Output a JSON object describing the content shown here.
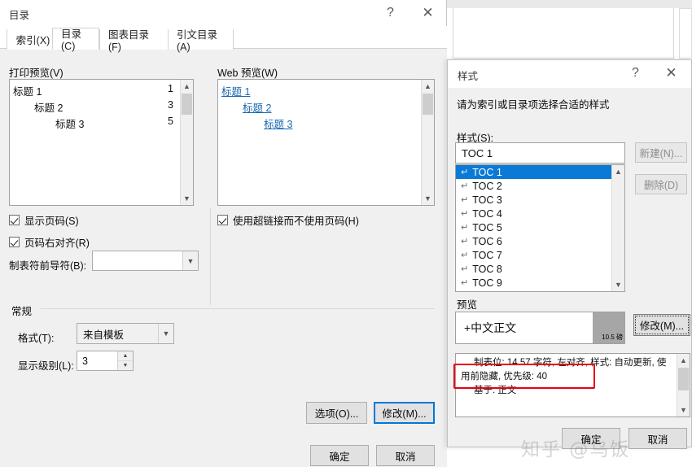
{
  "background": {
    "description": "word-document-page"
  },
  "toc_dialog": {
    "title": "目录",
    "help_icon": "?",
    "close_icon": "✕",
    "tabs": [
      {
        "label": "索引(X)",
        "active": false
      },
      {
        "label": "目录(C)",
        "active": true
      },
      {
        "label": "图表目录(F)",
        "active": false
      },
      {
        "label": "引文目录(A)",
        "active": false
      }
    ],
    "print_preview": {
      "label": "打印预览(V)",
      "lines": [
        {
          "text": "标题 1",
          "page": "1",
          "indent": 0
        },
        {
          "text": "标题 2",
          "page": "3",
          "indent": 26
        },
        {
          "text": "标题 3",
          "page": "5",
          "indent": 52
        }
      ]
    },
    "web_preview": {
      "label": "Web 预览(W)",
      "lines": [
        {
          "text": "标题 1",
          "indent": 0
        },
        {
          "text": "标题 2",
          "indent": 26
        },
        {
          "text": "标题 3",
          "indent": 52
        }
      ]
    },
    "checkbox_show_page_numbers": {
      "label": "显示页码(S)",
      "checked": true
    },
    "checkbox_right_align": {
      "label": "页码右对齐(R)",
      "checked": true
    },
    "checkbox_hyperlinks": {
      "label": "使用超链接而不使用页码(H)",
      "checked": true
    },
    "tab_leader": {
      "label": "制表符前导符(B):",
      "value": ""
    },
    "general": {
      "group_label": "常规",
      "format_label": "格式(T):",
      "format_value": "来自模板",
      "levels_label": "显示级别(L):",
      "levels_value": "3"
    },
    "options_button": "选项(O)...",
    "modify_button": "修改(M)...",
    "ok_button": "确定",
    "cancel_button": "取消"
  },
  "styles_dialog": {
    "title": "样式",
    "help_icon": "?",
    "close_icon": "✕",
    "instruction": "请为索引或目录项选择合适的样式",
    "styles_label": "样式(S):",
    "style_input_value": "TOC 1",
    "style_list": [
      {
        "label": "TOC 1",
        "selected": true
      },
      {
        "label": "TOC 2",
        "selected": false
      },
      {
        "label": "TOC 3",
        "selected": false
      },
      {
        "label": "TOC 4",
        "selected": false
      },
      {
        "label": "TOC 5",
        "selected": false
      },
      {
        "label": "TOC 6",
        "selected": false
      },
      {
        "label": "TOC 7",
        "selected": false
      },
      {
        "label": "TOC 8",
        "selected": false
      },
      {
        "label": "TOC 9",
        "selected": false
      }
    ],
    "new_button": "新建(N)...",
    "delete_button": "删除(D)",
    "preview_label": "预览",
    "preview_font_name": "+中文正文",
    "preview_font_size": "10.5 磅",
    "modify_button": "修改(M)...",
    "description_line1": "制表位: 14.57 字符, 左对齐, 样式: 自动更新, 使",
    "description_line2": "用前隐藏, 优先级: 40",
    "description_line3": "基于: 正文",
    "ok_button": "确定",
    "cancel_button": "取消"
  },
  "annotation": {
    "highlight_color": "#e60012"
  },
  "watermark": {
    "text": "知乎 @乌饭"
  }
}
